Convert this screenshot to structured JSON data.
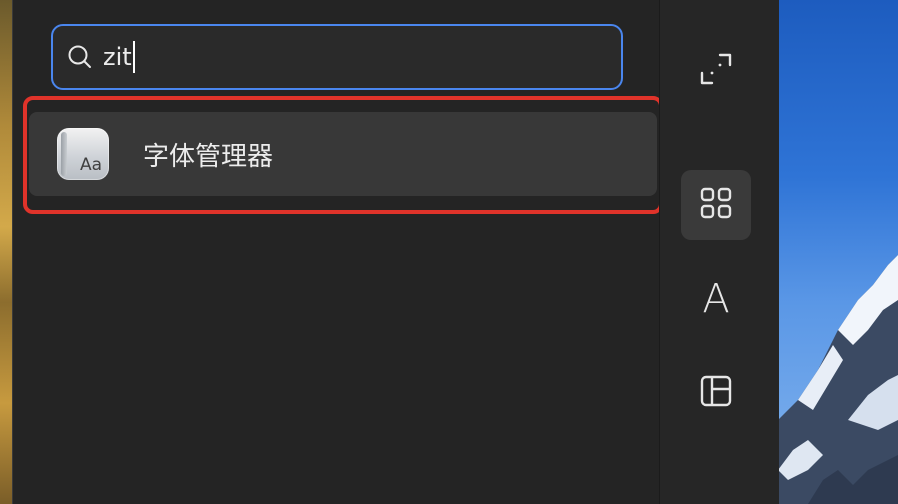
{
  "search": {
    "query": "zit"
  },
  "results": [
    {
      "label": "字体管理器",
      "icon": "font-book-icon",
      "icon_text": "Aa"
    }
  ],
  "rail": {
    "expand_icon": "expand-icon",
    "grid_icon": "grid-icon",
    "font_glyph": "A",
    "layout_icon": "layout-icon"
  },
  "colors": {
    "panel_bg": "#242424",
    "search_border": "#4a86ee",
    "highlight_border": "#e0332a",
    "result_bg": "#383838"
  }
}
